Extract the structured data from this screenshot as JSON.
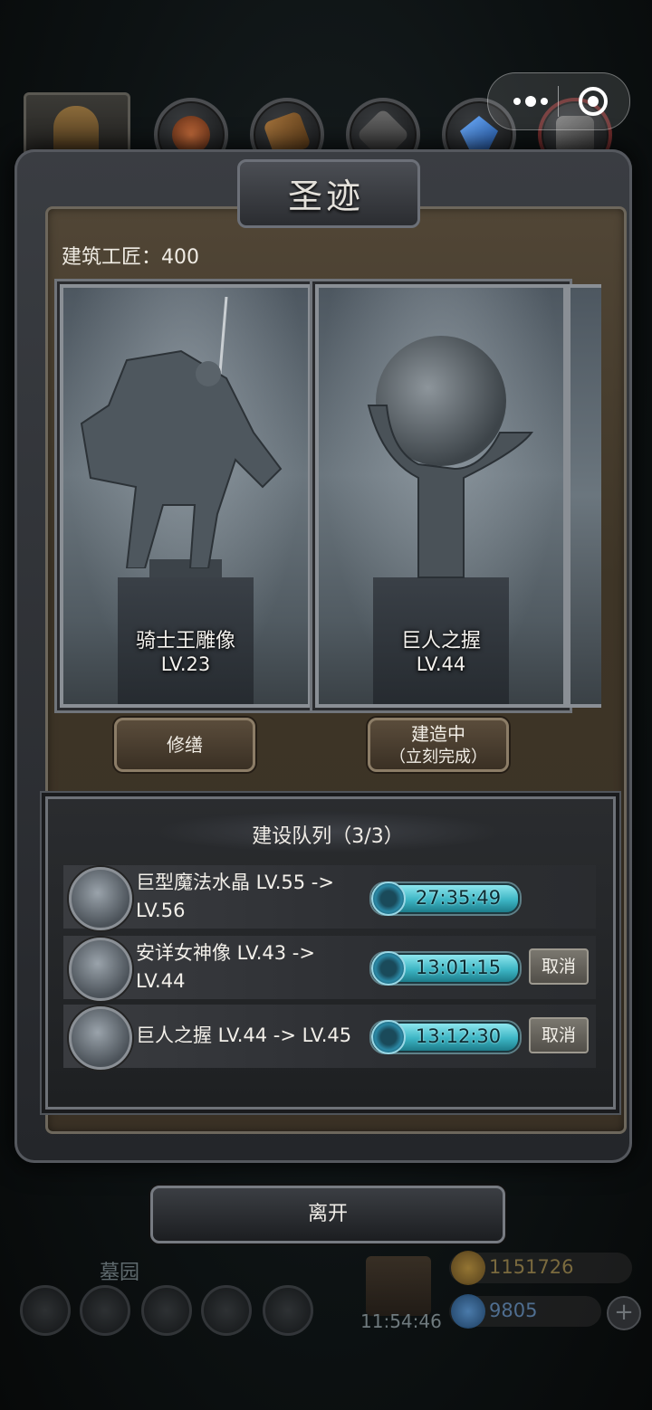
{
  "panel": {
    "title": "圣迹",
    "craftsmen": "建筑工匠：400"
  },
  "cards": [
    {
      "name": "骑士王雕像",
      "level": "LV.23"
    },
    {
      "name": "巨人之握",
      "level": "LV.44"
    }
  ],
  "buttons": {
    "repair": "修缮",
    "building_line1": "建造中",
    "building_line2": "（立刻完成）",
    "leave": "离开"
  },
  "queue": {
    "title": "建设队列（3/3）",
    "items": [
      {
        "line1": "巨型魔法水晶 LV.55 ->",
        "line2": "LV.56",
        "timer": "27:35:49",
        "cancel": ""
      },
      {
        "line1": "安详女神像 LV.43 ->",
        "line2": "LV.44",
        "timer": "13:01:15",
        "cancel": "取消"
      },
      {
        "line1": "巨人之握 LV.44 -> LV.45",
        "line2": "",
        "timer": "13:12:30",
        "cancel": "取消"
      }
    ]
  },
  "background": {
    "location": "墓园",
    "gift_timer": "11:54:46",
    "gold": "1151726",
    "gems": "9805"
  },
  "colors": {
    "timer_fill": "#3cb5c4",
    "panel_brown": "#3e3527",
    "frame_steel": "#55585e"
  }
}
